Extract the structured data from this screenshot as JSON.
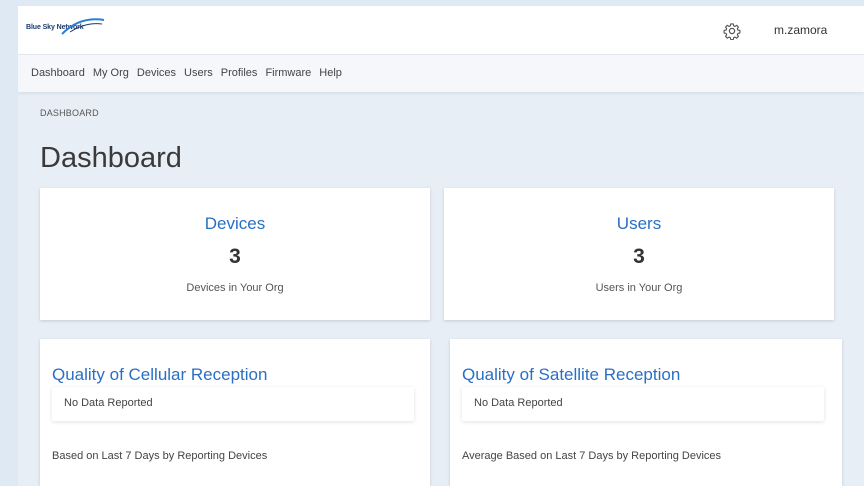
{
  "header": {
    "logo_text": "Blue Sky Network",
    "username": "m.zamora",
    "settings_icon": "gear-icon"
  },
  "nav": {
    "items": [
      "Dashboard",
      "My Org",
      "Devices",
      "Users",
      "Profiles",
      "Firmware",
      "Help"
    ]
  },
  "breadcrumb": "DASHBOARD",
  "page_title": "Dashboard",
  "stats": {
    "devices": {
      "title": "Devices",
      "count": "3",
      "caption": "Devices in Your Org"
    },
    "users": {
      "title": "Users",
      "count": "3",
      "caption": "Users in Your Org"
    }
  },
  "reception": {
    "cellular": {
      "title": "Quality of Cellular Reception",
      "status": "No Data Reported",
      "note": "Based on Last 7 Days by Reporting Devices"
    },
    "satellite": {
      "title": "Quality of Satellite Reception",
      "status": "No Data Reported",
      "note": "Average Based on Last 7 Days by Reporting Devices"
    }
  },
  "colors": {
    "accent": "#2a6fc4",
    "background": "#e8eef6"
  }
}
